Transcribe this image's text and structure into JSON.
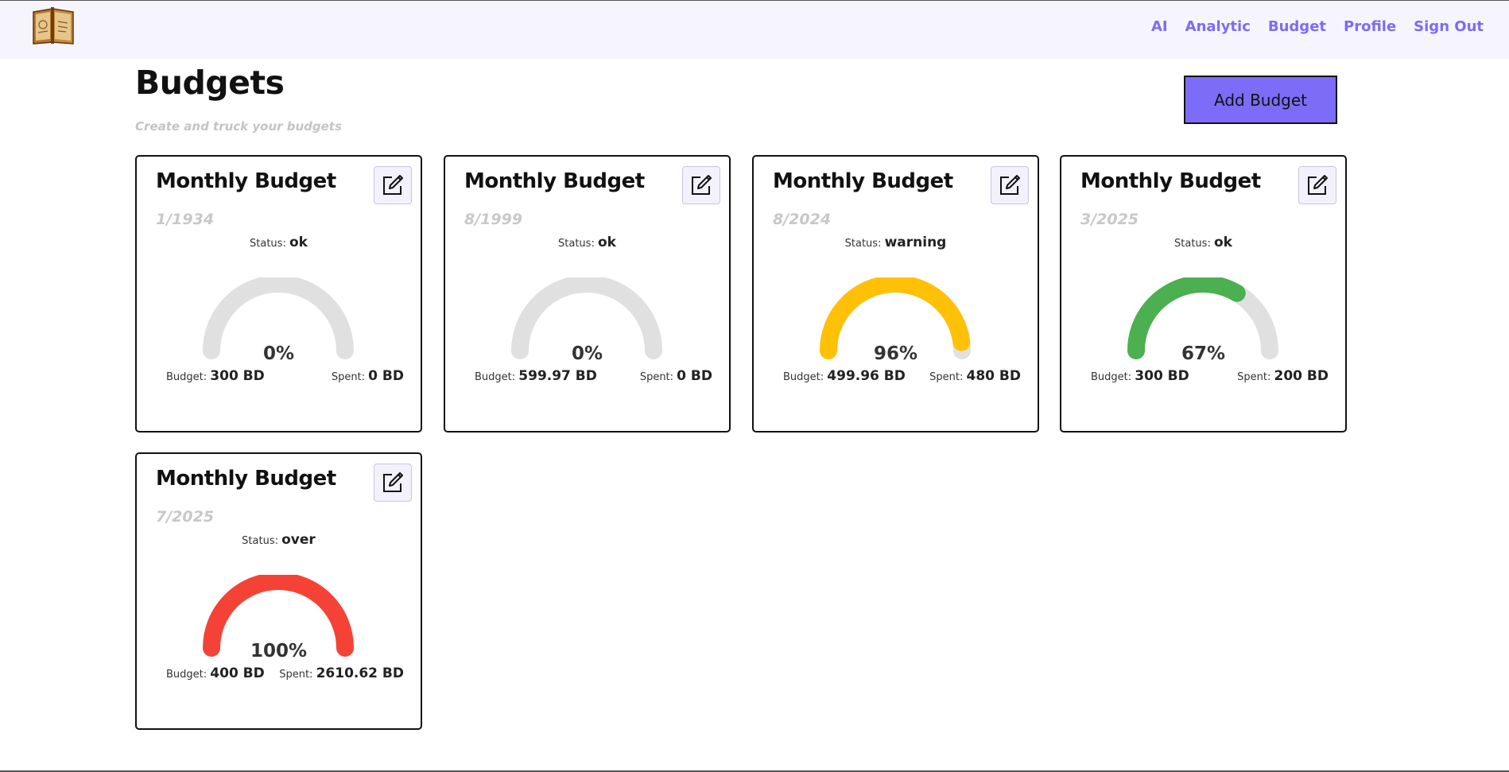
{
  "nav": {
    "items": [
      "AI",
      "Analytic",
      "Budget",
      "Profile",
      "Sign Out"
    ]
  },
  "page": {
    "title": "Budgets",
    "subtitle": "Create and truck your budgets",
    "add_button": "Add Budget"
  },
  "labels": {
    "status": "Status:",
    "budget": "Budget:",
    "spent": "Spent:"
  },
  "colors": {
    "accent": "#7c6cf8",
    "nav": "#7c6cf2",
    "track": "#e0e0e0",
    "ok": "#4caf50",
    "warning": "#ffc107",
    "over": "#f44336"
  },
  "cards": [
    {
      "title": "Monthly Budget",
      "date": "1/1934",
      "status": "ok",
      "percent_label": "0%",
      "percent": 0,
      "color": "#4caf50",
      "budget": "300 BD",
      "spent": "0 BD"
    },
    {
      "title": "Monthly Budget",
      "date": "8/1999",
      "status": "ok",
      "percent_label": "0%",
      "percent": 0,
      "color": "#4caf50",
      "budget": "599.97 BD",
      "spent": "0 BD"
    },
    {
      "title": "Monthly Budget",
      "date": "8/2024",
      "status": "warning",
      "percent_label": "96%",
      "percent": 96,
      "color": "#ffc107",
      "budget": "499.96 BD",
      "spent": "480 BD"
    },
    {
      "title": "Monthly Budget",
      "date": "3/2025",
      "status": "ok",
      "percent_label": "67%",
      "percent": 67,
      "color": "#4caf50",
      "budget": "300 BD",
      "spent": "200 BD"
    },
    {
      "title": "Monthly Budget",
      "date": "7/2025",
      "status": "over",
      "percent_label": "100%",
      "percent": 100,
      "color": "#f44336",
      "budget": "400 BD",
      "spent": "2610.62 BD"
    }
  ]
}
